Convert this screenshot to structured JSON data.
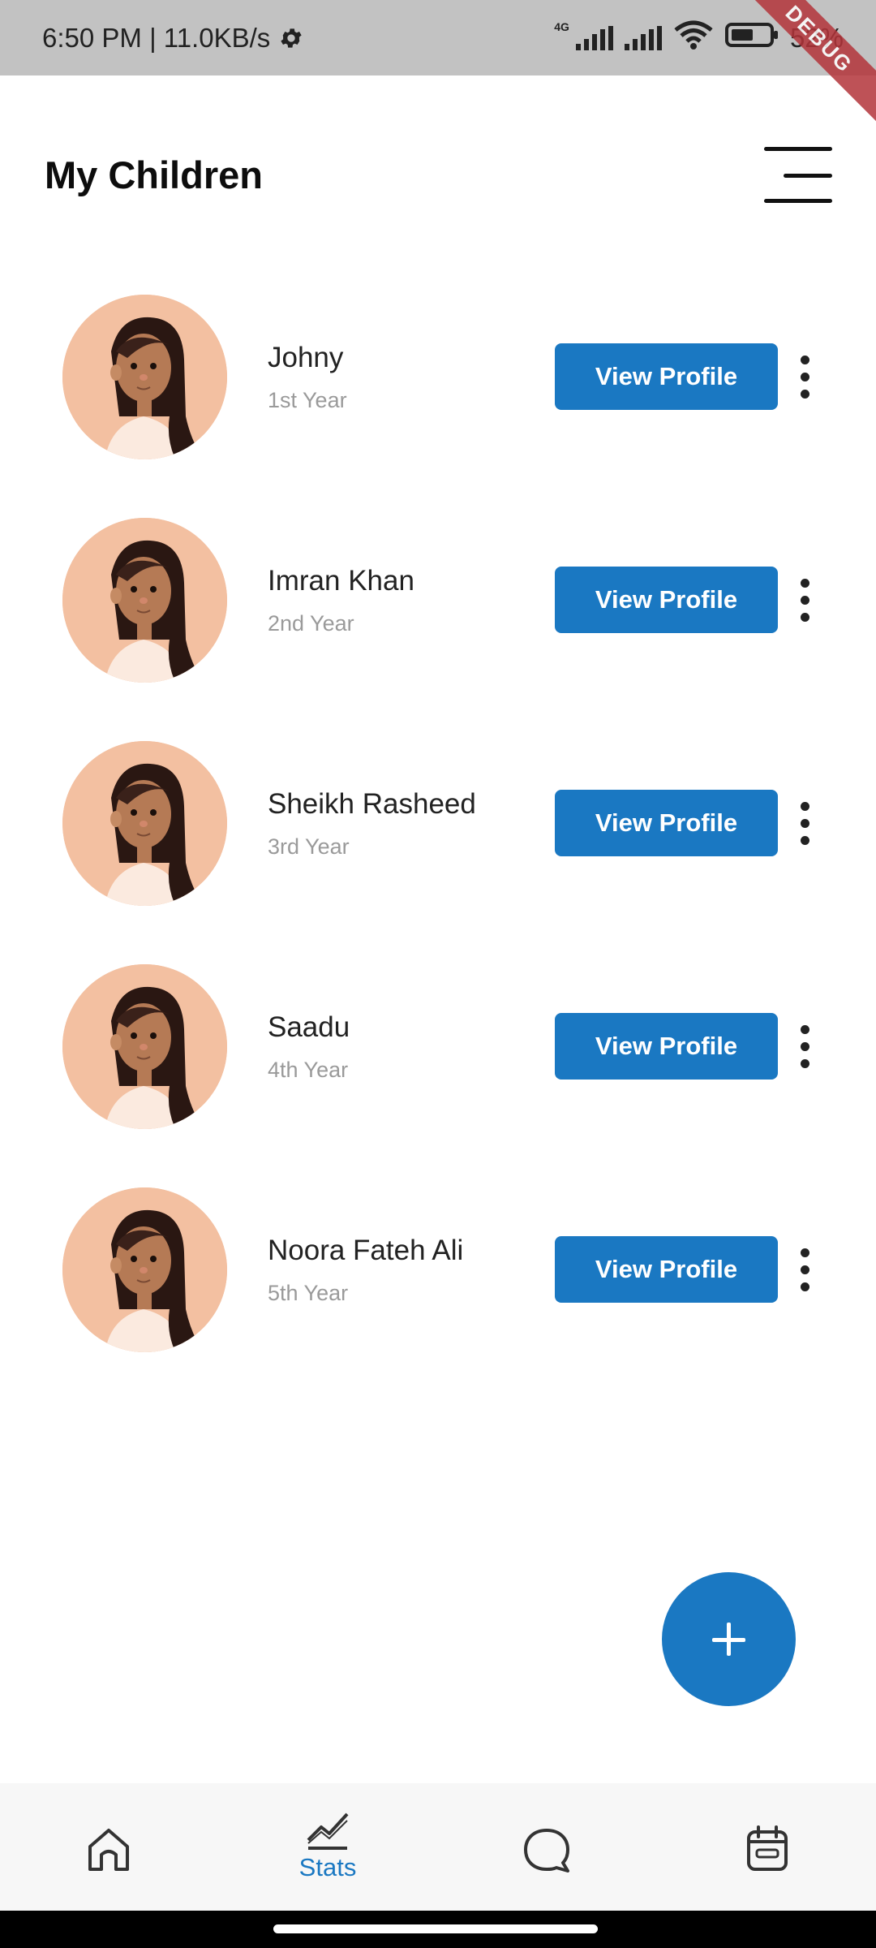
{
  "status_bar": {
    "time_speed": "6:50 PM | 11.0KB/s",
    "network_type": "4G",
    "battery_text": "52%",
    "debug_label": "DEBUG",
    "icons": [
      "gear-icon",
      "signal-icon",
      "wifi-icon",
      "battery-icon"
    ]
  },
  "header": {
    "title": "My Children",
    "menu_icon": "hamburger-menu-icon"
  },
  "children": [
    {
      "name": "Johny",
      "year": "1st Year",
      "button": "View Profile"
    },
    {
      "name": "Imran Khan",
      "year": "2nd Year",
      "button": "View Profile"
    },
    {
      "name": "Sheikh Rasheed",
      "year": "3rd Year",
      "button": "View Profile"
    },
    {
      "name": "Saadu",
      "year": "4th Year",
      "button": "View Profile"
    },
    {
      "name": "Noora Fateh Ali",
      "year": "5th Year",
      "button": "View Profile"
    }
  ],
  "fab": {
    "icon": "plus-icon"
  },
  "bottom_nav": {
    "active_index": 1,
    "items": [
      {
        "icon": "home-icon",
        "label": ""
      },
      {
        "icon": "stats-icon",
        "label": "Stats"
      },
      {
        "icon": "chat-icon",
        "label": ""
      },
      {
        "icon": "calendar-icon",
        "label": ""
      }
    ]
  },
  "colors": {
    "accent": "#1a78c2",
    "avatar_bg": "#f3c0a1",
    "status_bar_bg": "#c2c2c2",
    "nav_bg": "#f7f7f7",
    "subtext": "#9a9a9a"
  }
}
